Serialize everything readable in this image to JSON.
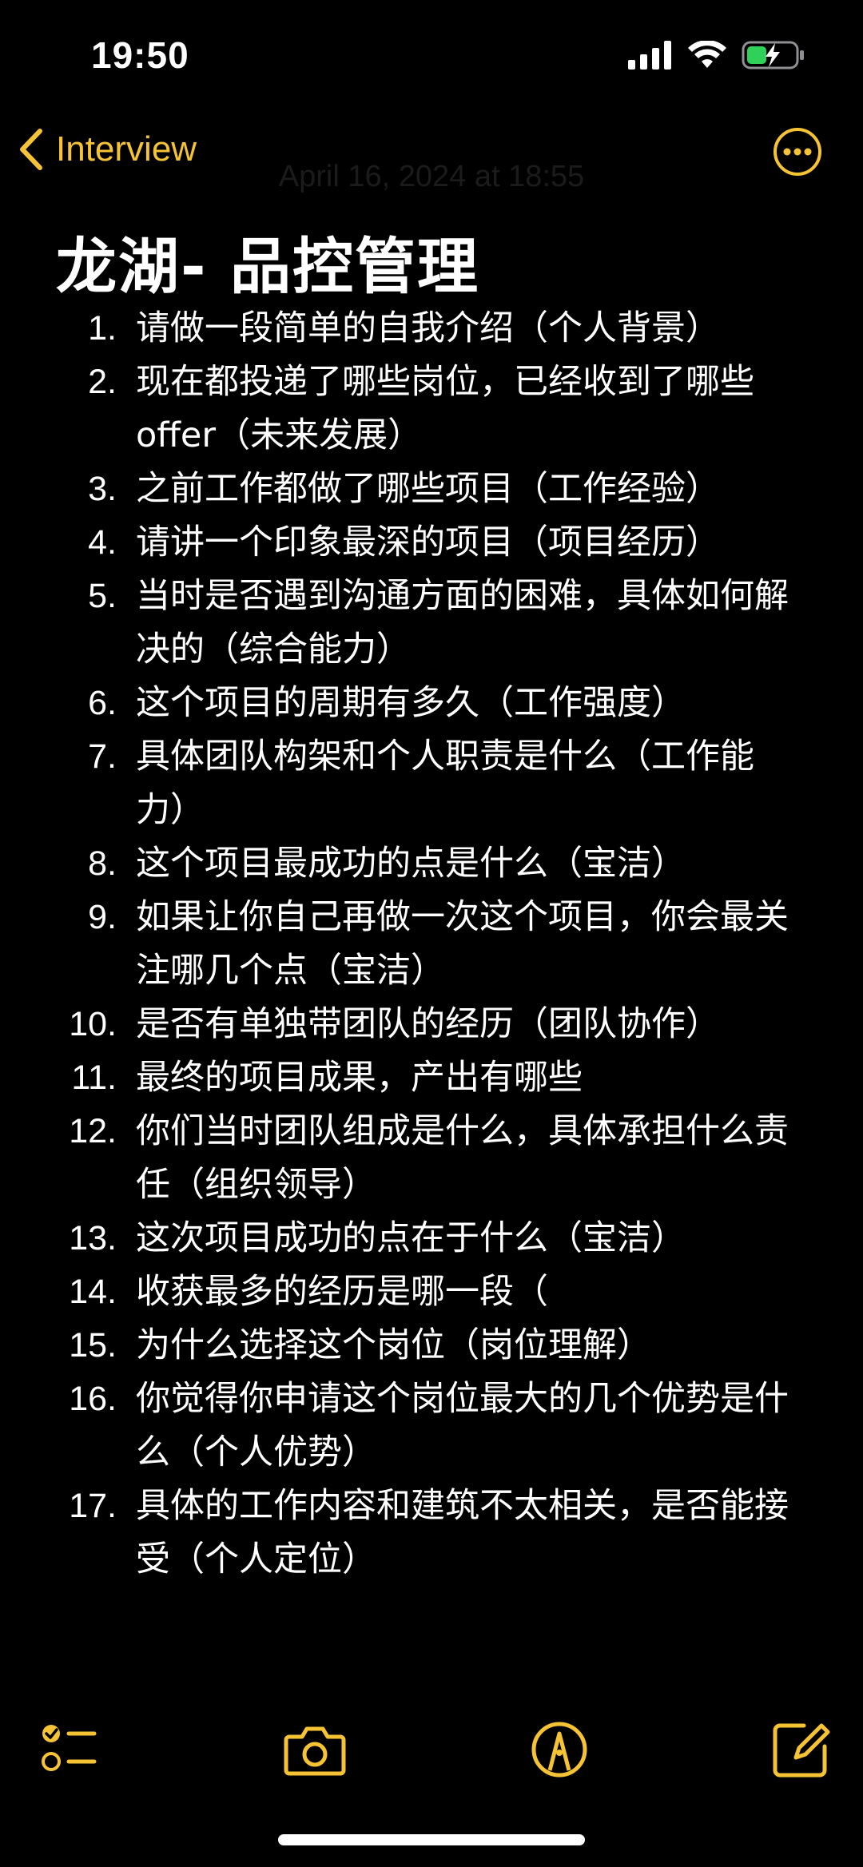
{
  "status_bar": {
    "time": "19:50"
  },
  "nav": {
    "back_label": "Interview",
    "date_text": "April 16, 2024 at 18:55"
  },
  "note": {
    "title": "龙湖- 品控管理",
    "questions": [
      {
        "num": "1.",
        "text": "请做一段简单的自我介绍（个人背景）"
      },
      {
        "num": "2.",
        "text": "现在都投递了哪些岗位，已经收到了哪些offer（未来发展）"
      },
      {
        "num": "3.",
        "text": "之前工作都做了哪些项目（工作经验）"
      },
      {
        "num": "4.",
        "text": "请讲一个印象最深的项目（项目经历）"
      },
      {
        "num": "5.",
        "text": "当时是否遇到沟通方面的困难，具体如何解决的（综合能力）"
      },
      {
        "num": "6.",
        "text": "这个项目的周期有多久（工作强度）"
      },
      {
        "num": "7.",
        "text": "具体团队构架和个人职责是什么（工作能力）"
      },
      {
        "num": "8.",
        "text": "这个项目最成功的点是什么（宝洁）"
      },
      {
        "num": "9.",
        "text": "如果让你自己再做一次这个项目，你会最关注哪几个点（宝洁）"
      },
      {
        "num": "10.",
        "text": "是否有单独带团队的经历（团队协作）"
      },
      {
        "num": "11.",
        "text": "最终的项目成果，产出有哪些"
      },
      {
        "num": "12.",
        "text": "你们当时团队组成是什么，具体承担什么责任（组织领导）"
      },
      {
        "num": "13.",
        "text": "这次项目成功的点在于什么（宝洁）"
      },
      {
        "num": "14.",
        "text": "收获最多的经历是哪一段（"
      },
      {
        "num": "15.",
        "text": "为什么选择这个岗位（岗位理解）"
      },
      {
        "num": "16.",
        "text": "你觉得你申请这个岗位最大的几个优势是什么（个人优势）"
      },
      {
        "num": "17.",
        "text": "具体的工作内容和建筑不太相关，是否能接受（个人定位）"
      }
    ]
  },
  "colors": {
    "accent": "#f6c335",
    "background": "#000000",
    "text": "#ffffff",
    "battery": "#30d158"
  },
  "icons": {
    "back": "chevron-left-icon",
    "more": "ellipsis-circle-icon",
    "checklist": "checklist-icon",
    "camera": "camera-icon",
    "markup": "pen-tip-icon",
    "compose": "compose-icon"
  }
}
